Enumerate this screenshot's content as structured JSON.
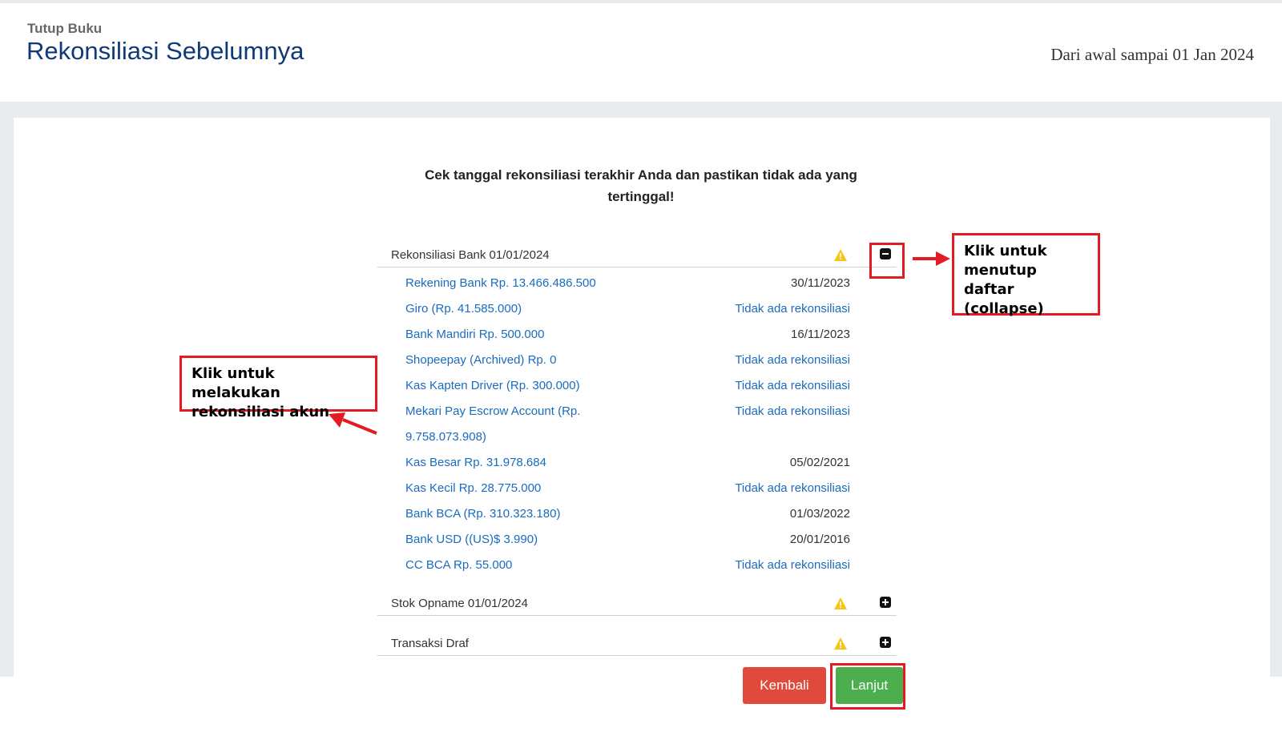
{
  "header": {
    "breadcrumb": "Tutup Buku",
    "title": "Rekonsiliasi Sebelumnya",
    "date_range": "Dari awal sampai 01 Jan 2024"
  },
  "instruction": "Cek tanggal rekonsiliasi terakhir Anda dan pastikan tidak ada yang tertinggal!",
  "sections": [
    {
      "title": "Rekonsiliasi Bank 01/01/2024",
      "expanded": true,
      "warning_icon": "warning-icon",
      "toggle_icon": "minus-square-icon"
    },
    {
      "title": "Stok Opname 01/01/2024",
      "expanded": false,
      "warning_icon": "warning-icon",
      "toggle_icon": "plus-square-icon"
    },
    {
      "title": "Transaksi Draf",
      "expanded": false,
      "warning_icon": "warning-icon",
      "toggle_icon": "plus-square-icon"
    }
  ],
  "bank_accounts": [
    {
      "name": "Rekening Bank Rp. 13.466.486.500",
      "status": "30/11/2023"
    },
    {
      "name": "Giro (Rp. 41.585.000)",
      "status": "Tidak ada rekonsiliasi"
    },
    {
      "name": "Bank Mandiri Rp. 500.000",
      "status": "16/11/2023"
    },
    {
      "name": "Shopeepay (Archived) Rp. 0",
      "status": "Tidak ada rekonsiliasi"
    },
    {
      "name": "Kas Kapten Driver (Rp. 300.000)",
      "status": "Tidak ada rekonsiliasi"
    },
    {
      "name": "Mekari Pay Escrow Account (Rp.",
      "status": "Tidak ada rekonsiliasi"
    },
    {
      "name": "9.758.073.908)",
      "status": ""
    },
    {
      "name": "Kas Besar Rp. 31.978.684",
      "status": "05/02/2021"
    },
    {
      "name": "Kas Kecil Rp. 28.775.000",
      "status": "Tidak ada rekonsiliasi"
    },
    {
      "name": "Bank BCA (Rp. 310.323.180)",
      "status": "01/03/2022"
    },
    {
      "name": "Bank USD ((US)$ 3.990)",
      "status": "20/01/2016"
    },
    {
      "name": "CC BCA Rp. 55.000",
      "status": "Tidak ada rekonsiliasi"
    }
  ],
  "buttons": {
    "back": "Kembali",
    "next": "Lanjut"
  },
  "annotations": {
    "collapse": [
      "Klik untuk",
      "menutup daftar",
      "(collapse)"
    ],
    "reconcile": [
      "Klik untuk melakukan",
      "rekonsiliasi akun"
    ]
  },
  "colors": {
    "title_blue": "#0f3a78",
    "link_blue": "#1a6bbf",
    "warning_yellow": "#f5c518",
    "back_red": "#e04a3b",
    "next_green": "#4cae4c",
    "annotation_red": "#e31c23"
  }
}
